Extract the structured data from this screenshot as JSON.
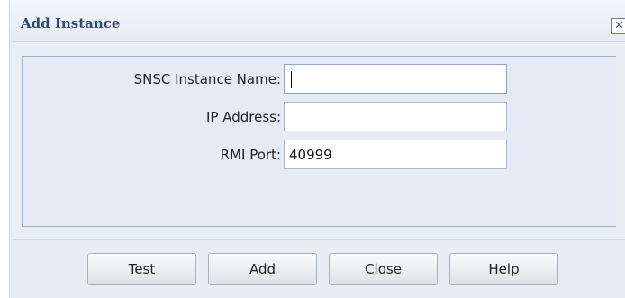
{
  "dialog": {
    "title": "Add Instance",
    "close_icon": "×",
    "colors": {
      "title_text": "#2c4a78",
      "panel_border": "#9fb4cf",
      "panel_bg": "#e4ebf5"
    }
  },
  "form": {
    "fields": [
      {
        "label": "SNSC Instance Name:",
        "value": "",
        "focused": true
      },
      {
        "label": "IP Address:",
        "value": "",
        "focused": false
      },
      {
        "label": "RMI Port:",
        "value": "40999",
        "focused": false
      }
    ]
  },
  "actions": {
    "test_label": "Test",
    "add_label": "Add",
    "close_label": "Close",
    "help_label": "Help"
  }
}
